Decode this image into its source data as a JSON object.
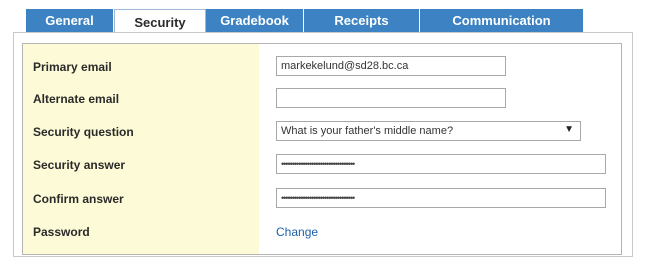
{
  "tabs": [
    {
      "label": "General",
      "active": false
    },
    {
      "label": "Security",
      "active": true
    },
    {
      "label": "Gradebook",
      "active": false
    },
    {
      "label": "Receipts",
      "active": false
    },
    {
      "label": "Communication",
      "active": false
    }
  ],
  "form": {
    "primary_email": {
      "label": "Primary email",
      "value": "markekelund@sd28.bc.ca"
    },
    "alternate_email": {
      "label": "Alternate email",
      "value": ""
    },
    "security_question": {
      "label": "Security question",
      "value": "What is your father's middle name?"
    },
    "security_answer": {
      "label": "Security answer",
      "value": "••••••••••••••••••••••••••••••••••"
    },
    "confirm_answer": {
      "label": "Confirm answer",
      "value": "••••••••••••••••••••••••••••••••••"
    },
    "password": {
      "label": "Password",
      "link": "Change"
    }
  },
  "colors": {
    "tab_bar": "#3d83c3",
    "label_column": "#fdfbd7",
    "link": "#1c5fa8"
  }
}
